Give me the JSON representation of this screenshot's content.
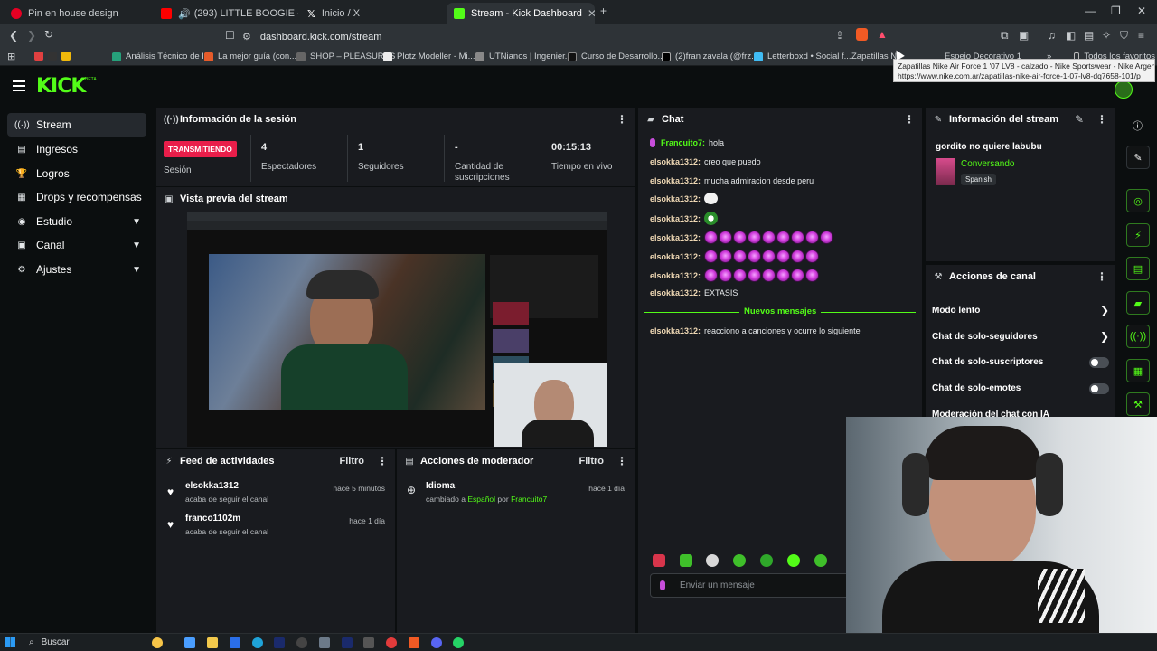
{
  "browser": {
    "tabs": [
      {
        "title": "Pin en house design",
        "color": "#e60023"
      },
      {
        "title": "(293) LITTLE BOOGIE - LOS DEL B",
        "color": "#ff0000"
      },
      {
        "title": "Inicio / X",
        "color": "#ffffff"
      },
      {
        "title": "Stream - Kick Dashboard",
        "color": "#53fc18"
      }
    ],
    "url": "dashboard.kick.com/stream",
    "bookmarks": [
      "Análisis Técnico de l...",
      "La mejor guía (con...",
      "SHOP – PLEASURES",
      "Plotz Modeller - Mi...",
      "UTNianos | Ingenier...",
      "Curso de Desarrollo...",
      "(2)fran zavala (@frz...",
      "Letterboxd • Social f...",
      "Zapatillas Nike Air F...",
      "Espejo Decorativo 1...",
      "Todos los favoritos"
    ],
    "tooltip_title": "Zapatillas Nike Air Force 1 '07 LV8 - calzado - Nike Sportswear - Nike Argentina.",
    "tooltip_url": "https://www.nike.com.ar/zapatillas-nike-air-force-1-07-lv8-dq7658-101/p"
  },
  "app": {
    "logo": "KICK",
    "logo_beta": "BETA",
    "nav": [
      {
        "label": "Stream",
        "icon": "((·))"
      },
      {
        "label": "Ingresos",
        "icon": "▤"
      },
      {
        "label": "Logros",
        "icon": "🏆"
      },
      {
        "label": "Drops y recompensas",
        "icon": "▦"
      },
      {
        "label": "Estudio",
        "icon": "◉"
      },
      {
        "label": "Canal",
        "icon": "▣"
      },
      {
        "label": "Ajustes",
        "icon": "⚙"
      }
    ]
  },
  "session": {
    "title": "Información de la sesión",
    "badge": "TRANSMITIENDO",
    "badge_label": "Sesión",
    "stats": [
      {
        "value": "4",
        "label": "Espectadores"
      },
      {
        "value": "1",
        "label": "Seguidores"
      },
      {
        "value": "-",
        "label": "Cantidad de suscripciones"
      },
      {
        "value": "00:15:13",
        "label": "Tiempo en vivo"
      }
    ]
  },
  "preview": {
    "title": "Vista previa del stream"
  },
  "feed": {
    "title": "Feed de actividades",
    "filter": "Filtro",
    "items": [
      {
        "name": "elsokka1312",
        "desc": "acaba de seguir el canal",
        "time": "hace 5 minutos"
      },
      {
        "name": "franco1102m",
        "desc": "acaba de seguir el canal",
        "time": "hace 1 día"
      }
    ]
  },
  "moderator": {
    "title": "Acciones de moderador",
    "filter": "Filtro",
    "item_title": "Idioma",
    "item_pre": "cambiado a",
    "item_value": "Español",
    "item_by": "por",
    "item_user": "Francuito7",
    "item_time": "hace 1 día"
  },
  "chat": {
    "title": "Chat",
    "messages": [
      {
        "user": "Francuito7:",
        "text": "hola"
      },
      {
        "user": "elsokka1312:",
        "text": "creo que puedo"
      },
      {
        "user": "elsokka1312:",
        "text": "mucha admiracion desde peru"
      },
      {
        "user": "elsokka1312:",
        "text": ""
      },
      {
        "user": "elsokka1312:",
        "text": ""
      },
      {
        "user": "elsokka1312:",
        "text": ""
      },
      {
        "user": "elsokka1312:",
        "text": ""
      },
      {
        "user": "elsokka1312:",
        "text": ""
      },
      {
        "user": "elsokka1312:",
        "text": "EXTASIS"
      }
    ],
    "divider": "Nuevos mensajes",
    "last": {
      "user": "elsokka1312:",
      "text": "reacciono a canciones y ocurre lo siguiente"
    },
    "placeholder": "Enviar un mensaje"
  },
  "stream_info": {
    "title": "Información del stream",
    "stream_title": "gordito no quiere labubu",
    "category": "Conversando",
    "language": "Spanish"
  },
  "channel_actions": {
    "title": "Acciones de canal",
    "rows": [
      "Modo lento",
      "Chat de solo-seguidores",
      "Chat de solo-suscriptores",
      "Chat de solo-emotes",
      "Moderación del chat con IA"
    ]
  },
  "taskbar": {
    "search": "Buscar"
  },
  "colors": {
    "accent": "#53fc18",
    "live": "#e91e4a",
    "panel": "#191b1f",
    "bg": "#0b0e0f"
  }
}
